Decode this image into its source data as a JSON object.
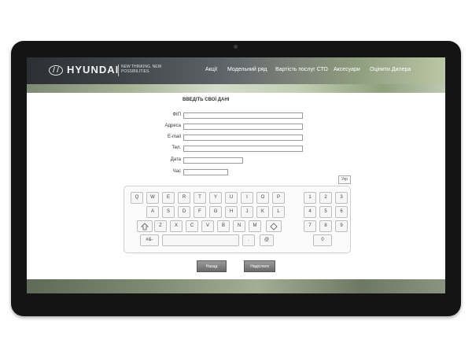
{
  "header": {
    "brand": "HYUNDAI",
    "tagline": "NEW THINKING. NEW POSSIBILITIES.",
    "nav": [
      "Акції",
      "Модельний ряд",
      "Вартість послуг СТО",
      "Аксесуари",
      "Оцінити Дилера"
    ]
  },
  "form": {
    "title": "ВВЕДІТЬ СВОЇ ДАНІ",
    "fields": [
      "ФІП",
      "Адреса",
      "E-mail",
      "Тел.",
      "Дата",
      "Час"
    ]
  },
  "keyboard": {
    "lang": "Укр",
    "row1": [
      "Q",
      "W",
      "E",
      "R",
      "T",
      "Y",
      "U",
      "I",
      "O",
      "P"
    ],
    "row2": [
      "A",
      "S",
      "D",
      "F",
      "G",
      "H",
      "J",
      "K",
      "L"
    ],
    "row3": [
      "Z",
      "X",
      "C",
      "V",
      "B",
      "N",
      "M"
    ],
    "symbols": "#&-",
    "dot": ".",
    "at": "@",
    "numpad": [
      "1",
      "2",
      "3",
      "4",
      "5",
      "6",
      "7",
      "8",
      "9",
      "0"
    ]
  },
  "buttons": {
    "back": "Назад",
    "send": "Надіслати"
  }
}
